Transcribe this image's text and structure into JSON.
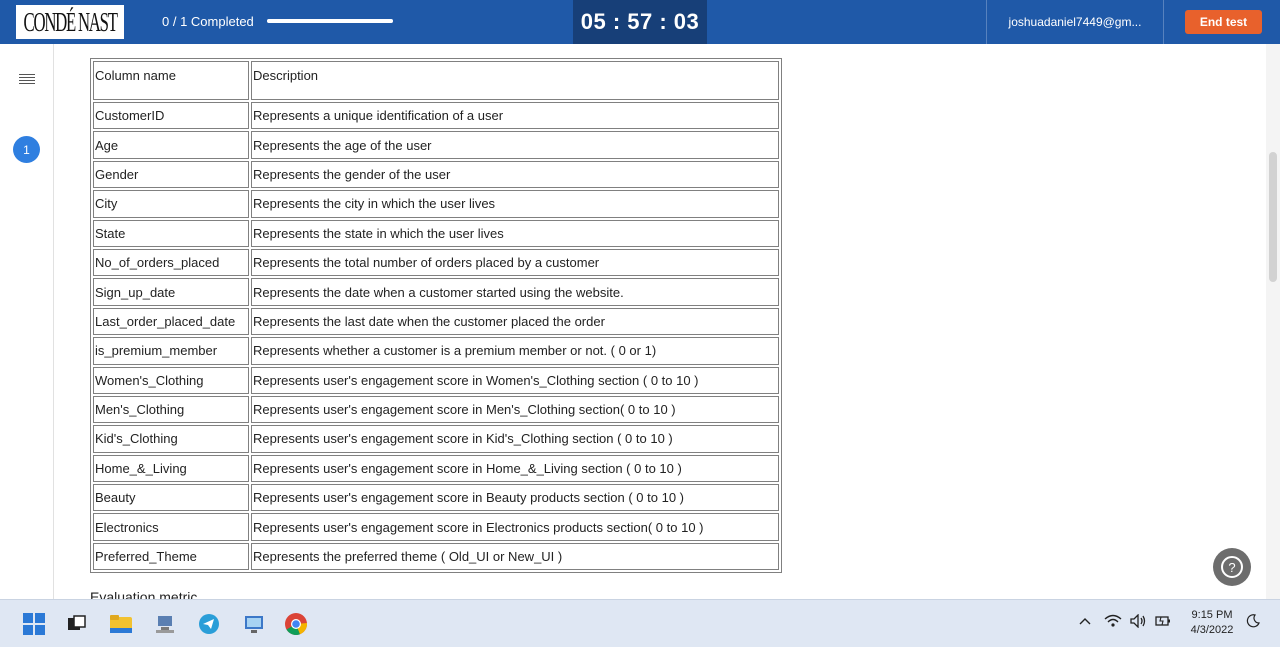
{
  "header": {
    "logo_text": "CONDÉ NAST",
    "progress_text": "0 / 1 Completed",
    "progress_fraction": 1.0,
    "timer": "05 : 57 : 03",
    "user_email": "joshuadaniel7449@gm...",
    "end_test_label": "End test"
  },
  "sidebar": {
    "question_number": "1"
  },
  "table": {
    "headers": [
      "Column name",
      "Description"
    ],
    "rows": [
      [
        "CustomerID",
        "Represents a unique identification of a user"
      ],
      [
        "Age",
        "Represents the age of the user"
      ],
      [
        "Gender",
        "Represents the gender of the user"
      ],
      [
        "City",
        "Represents the city in which the user lives"
      ],
      [
        "State",
        "Represents the state in which the user lives"
      ],
      [
        "No_of_orders_placed",
        "Represents the total number of orders placed by a customer"
      ],
      [
        "Sign_up_date",
        "Represents the date when a customer started using the website."
      ],
      [
        "Last_order_placed_date",
        "Represents the last date when the customer placed the order"
      ],
      [
        "is_premium_member",
        "Represents whether a customer is a premium member or not. ( 0 or 1)"
      ],
      [
        "Women's_Clothing",
        "Represents user's engagement score in Women's_Clothing section ( 0 to 10 )"
      ],
      [
        "Men's_Clothing",
        "Represents user's engagement score in Men's_Clothing section( 0 to 10 )"
      ],
      [
        "Kid's_Clothing",
        "Represents user's engagement score in Kid's_Clothing section ( 0 to 10 )"
      ],
      [
        "Home_&_Living",
        "Represents user's engagement score in  Home_&_Living section ( 0 to 10 )"
      ],
      [
        "Beauty",
        "Represents user's engagement score in Beauty products section ( 0 to 10 )"
      ],
      [
        "Electronics",
        "Represents user's engagement score in  Electronics products section( 0 to 10 )"
      ],
      [
        "Preferred_Theme",
        "Represents the preferred theme ( Old_UI or New_UI )"
      ]
    ]
  },
  "section_below": "Evaluation metric",
  "help_label": "?",
  "taskbar": {
    "time": "9:15 PM",
    "date": "4/3/2022"
  },
  "colors": {
    "header_bg": "#1f59a8",
    "timer_bg": "#173f78",
    "end_button": "#e8612c",
    "badge": "#2f7fe0"
  }
}
